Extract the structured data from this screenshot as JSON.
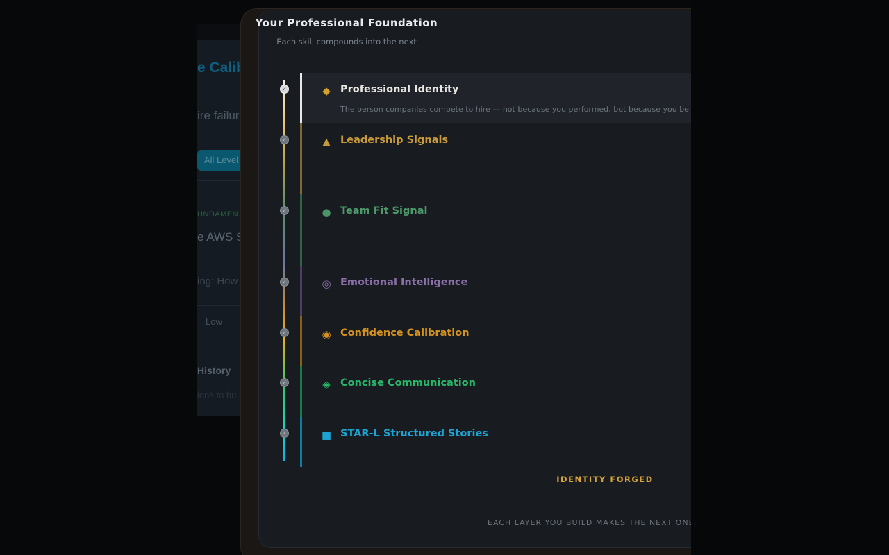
{
  "background": {
    "title": "e Calib",
    "subtitle": "ire failur",
    "chip_label": "All Level",
    "category": "UNDAMEN",
    "question": "e AWS Sh",
    "hint": "ing: How",
    "level": "Low",
    "history_title": "History",
    "history_sub": "ions to bu"
  },
  "modal": {
    "title": "Your Professional Foundation",
    "subtitle": "Each skill compounds into the next",
    "footer_badge": "IDENTITY FORGED",
    "footer_note": "EACH LAYER YOU BUILD MAKES THE NEXT ONE STR"
  },
  "layers": [
    {
      "name": "Professional Identity",
      "icon": "diamond-icon",
      "glyph": "◆",
      "color": "#e8e6e1",
      "icon_color": "#d4a12a",
      "bar_color": "#e9e9e9",
      "status": "active",
      "description": "The person companies compete to hire — not because you performed, but because you be"
    },
    {
      "name": "Leadership Signals",
      "icon": "triangle-icon",
      "glyph": "▲",
      "color": "#c99a3c",
      "icon_color": "#c49a3a",
      "bar_color": "#7f6a33",
      "status": "locked",
      "description": ""
    },
    {
      "name": "Team Fit Signal",
      "icon": "circle-icon",
      "glyph": "●",
      "color": "#4e9a6b",
      "icon_color": "#4b9468",
      "bar_color": "#2f6445",
      "status": "locked",
      "description": ""
    },
    {
      "name": "Emotional Intelligence",
      "icon": "target-icon",
      "glyph": "◎",
      "color": "#8a6fa8",
      "icon_color": "#8a6fa8",
      "bar_color": "#4e3e63",
      "status": "locked",
      "description": ""
    },
    {
      "name": "Confidence Calibration",
      "icon": "sun-icon",
      "glyph": "◉",
      "color": "#d4921e",
      "icon_color": "#d4921e",
      "bar_color": "#8a5f16",
      "status": "locked",
      "description": ""
    },
    {
      "name": "Concise Communication",
      "icon": "diamond-dot-icon",
      "glyph": "◈",
      "color": "#27b86a",
      "icon_color": "#27b86a",
      "bar_color": "#1a7a47",
      "status": "locked",
      "description": ""
    },
    {
      "name": "STAR-L Structured Stories",
      "icon": "square-icon",
      "glyph": "■",
      "color": "#1da3d3",
      "icon_color": "#1da3d3",
      "bar_color": "#137aa0",
      "status": "locked",
      "description": ""
    }
  ],
  "progress_dots": [
    {
      "status": "complete"
    },
    {
      "status": "complete"
    },
    {
      "status": "complete"
    },
    {
      "status": "complete"
    },
    {
      "status": "complete"
    },
    {
      "status": "complete"
    },
    {
      "status": "complete"
    }
  ]
}
